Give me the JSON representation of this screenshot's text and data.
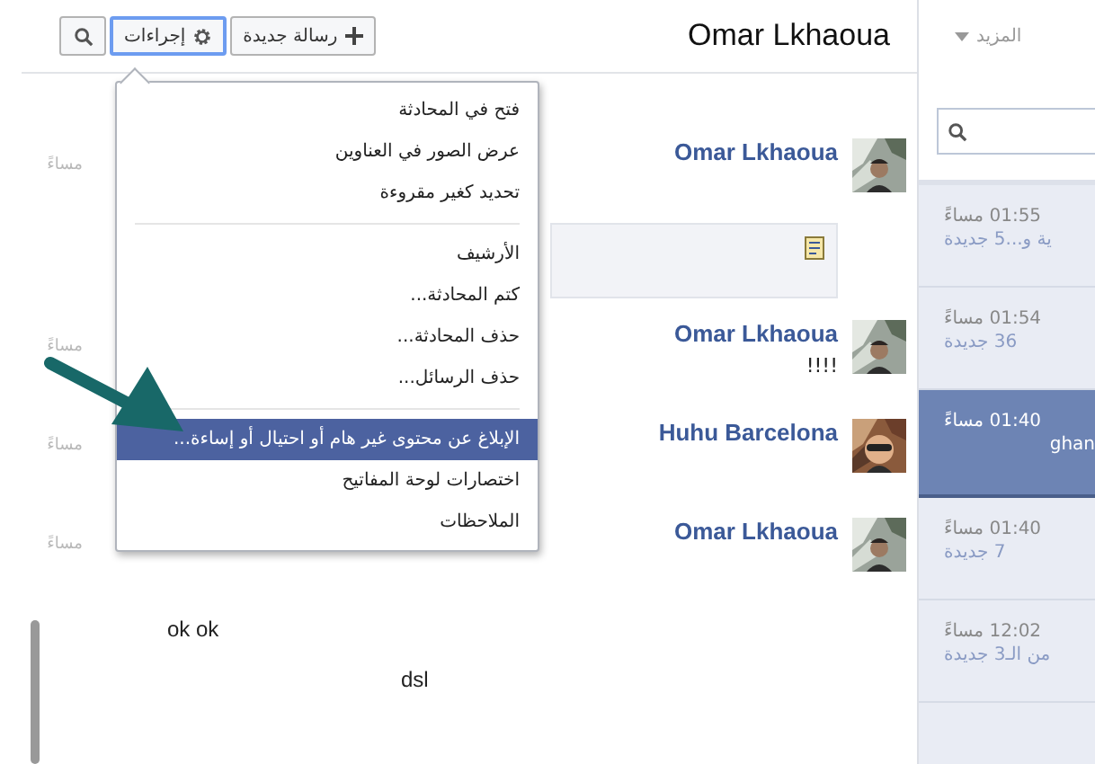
{
  "toolbar": {
    "new_message": "رسالة جديدة",
    "actions": "إجراءات",
    "actions_open": true
  },
  "conversation": {
    "title": "Omar Lkhaoua"
  },
  "more": "المزيد",
  "messages": [
    {
      "sender": "Omar Lkhaoua",
      "time": "مساءً",
      "attachment": true
    },
    {
      "sender": "Omar Lkhaoua",
      "time": "مساءً",
      "lines": [
        "!!!!"
      ],
      "attachment": false
    },
    {
      "sender": "Huhu Barcelona",
      "time": "مساءً",
      "attachment": false
    },
    {
      "sender": "Omar Lkhaoua",
      "time": "مساءً",
      "attachment": false
    }
  ],
  "trailing_lines": [
    "ok ok",
    "dsl"
  ],
  "menu": {
    "groups": [
      [
        {
          "label": "فتح في المحادثة",
          "selected": false
        },
        {
          "label": "عرض الصور في العناوين",
          "selected": false
        },
        {
          "label": "تحديد كغير مقروءة",
          "selected": false
        }
      ],
      [
        {
          "label": "الأرشيف",
          "selected": false
        },
        {
          "label": "كتم المحادثة...",
          "selected": false
        },
        {
          "label": "حذف المحادثة...",
          "selected": false
        },
        {
          "label": "حذف الرسائل...",
          "selected": false
        }
      ],
      [
        {
          "label": "الإبلاغ عن محتوى غير هام أو احتيال أو إساءة...",
          "selected": true
        },
        {
          "label": "اختصارات لوحة المفاتيح",
          "selected": false
        },
        {
          "label": "الملاحظات",
          "selected": false
        }
      ]
    ]
  },
  "threads": [
    {
      "time": "01:55 مساءً",
      "preview": "ية و...5 جديدة",
      "selected": false
    },
    {
      "time": "01:54 مساءً",
      "preview": "36 جديدة",
      "selected": false
    },
    {
      "time": "01:40 مساءً",
      "preview": "ghan",
      "selected": true
    },
    {
      "time": "01:40 مساءً",
      "preview": "7 جديدة",
      "selected": false
    },
    {
      "time": "12:02 مساءً",
      "preview": "من الـ3 جديدة",
      "selected": false
    }
  ]
}
